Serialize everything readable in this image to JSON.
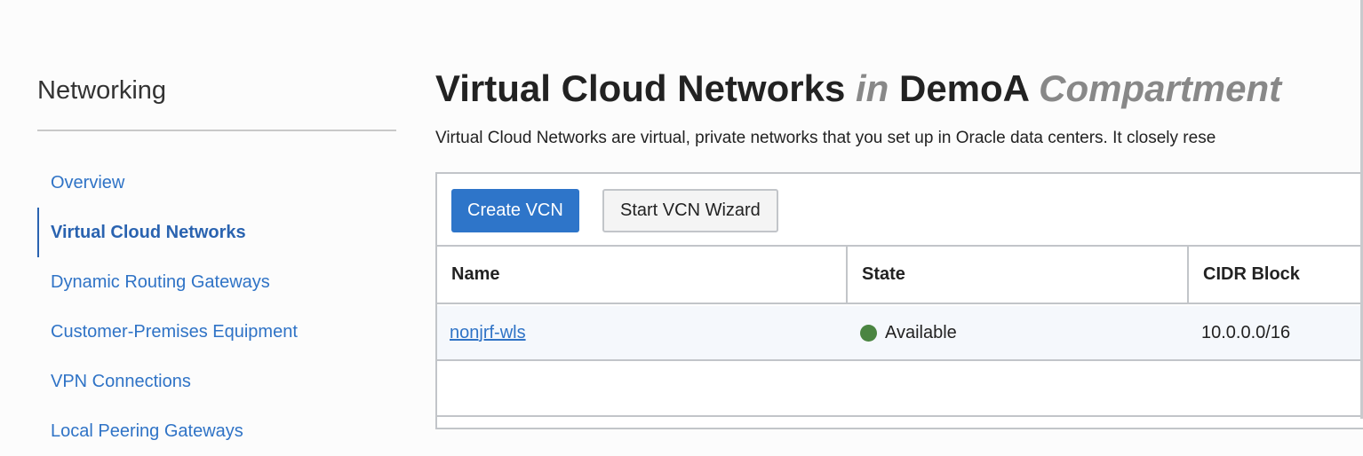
{
  "sidebar": {
    "title": "Networking",
    "items": [
      {
        "label": "Overview"
      },
      {
        "label": "Virtual Cloud Networks",
        "active": true
      },
      {
        "label": "Dynamic Routing Gateways"
      },
      {
        "label": "Customer-Premises Equipment"
      },
      {
        "label": "VPN Connections"
      },
      {
        "label": "Local Peering Gateways"
      }
    ]
  },
  "header": {
    "title_main": "Virtual Cloud Networks",
    "title_in": "in",
    "title_compartment": "DemoA",
    "title_suffix": "Compartment",
    "description": "Virtual Cloud Networks are virtual, private networks that you set up in Oracle data centers. It closely rese"
  },
  "toolbar": {
    "create_label": "Create VCN",
    "wizard_label": "Start VCN Wizard"
  },
  "table": {
    "columns": [
      "Name",
      "State",
      "CIDR Block"
    ],
    "rows": [
      {
        "name": "nonjrf-wls",
        "state": "Available",
        "cidr": "10.0.0.0/16"
      }
    ]
  },
  "colors": {
    "accent": "#2e75c9",
    "available": "#4a8541"
  }
}
